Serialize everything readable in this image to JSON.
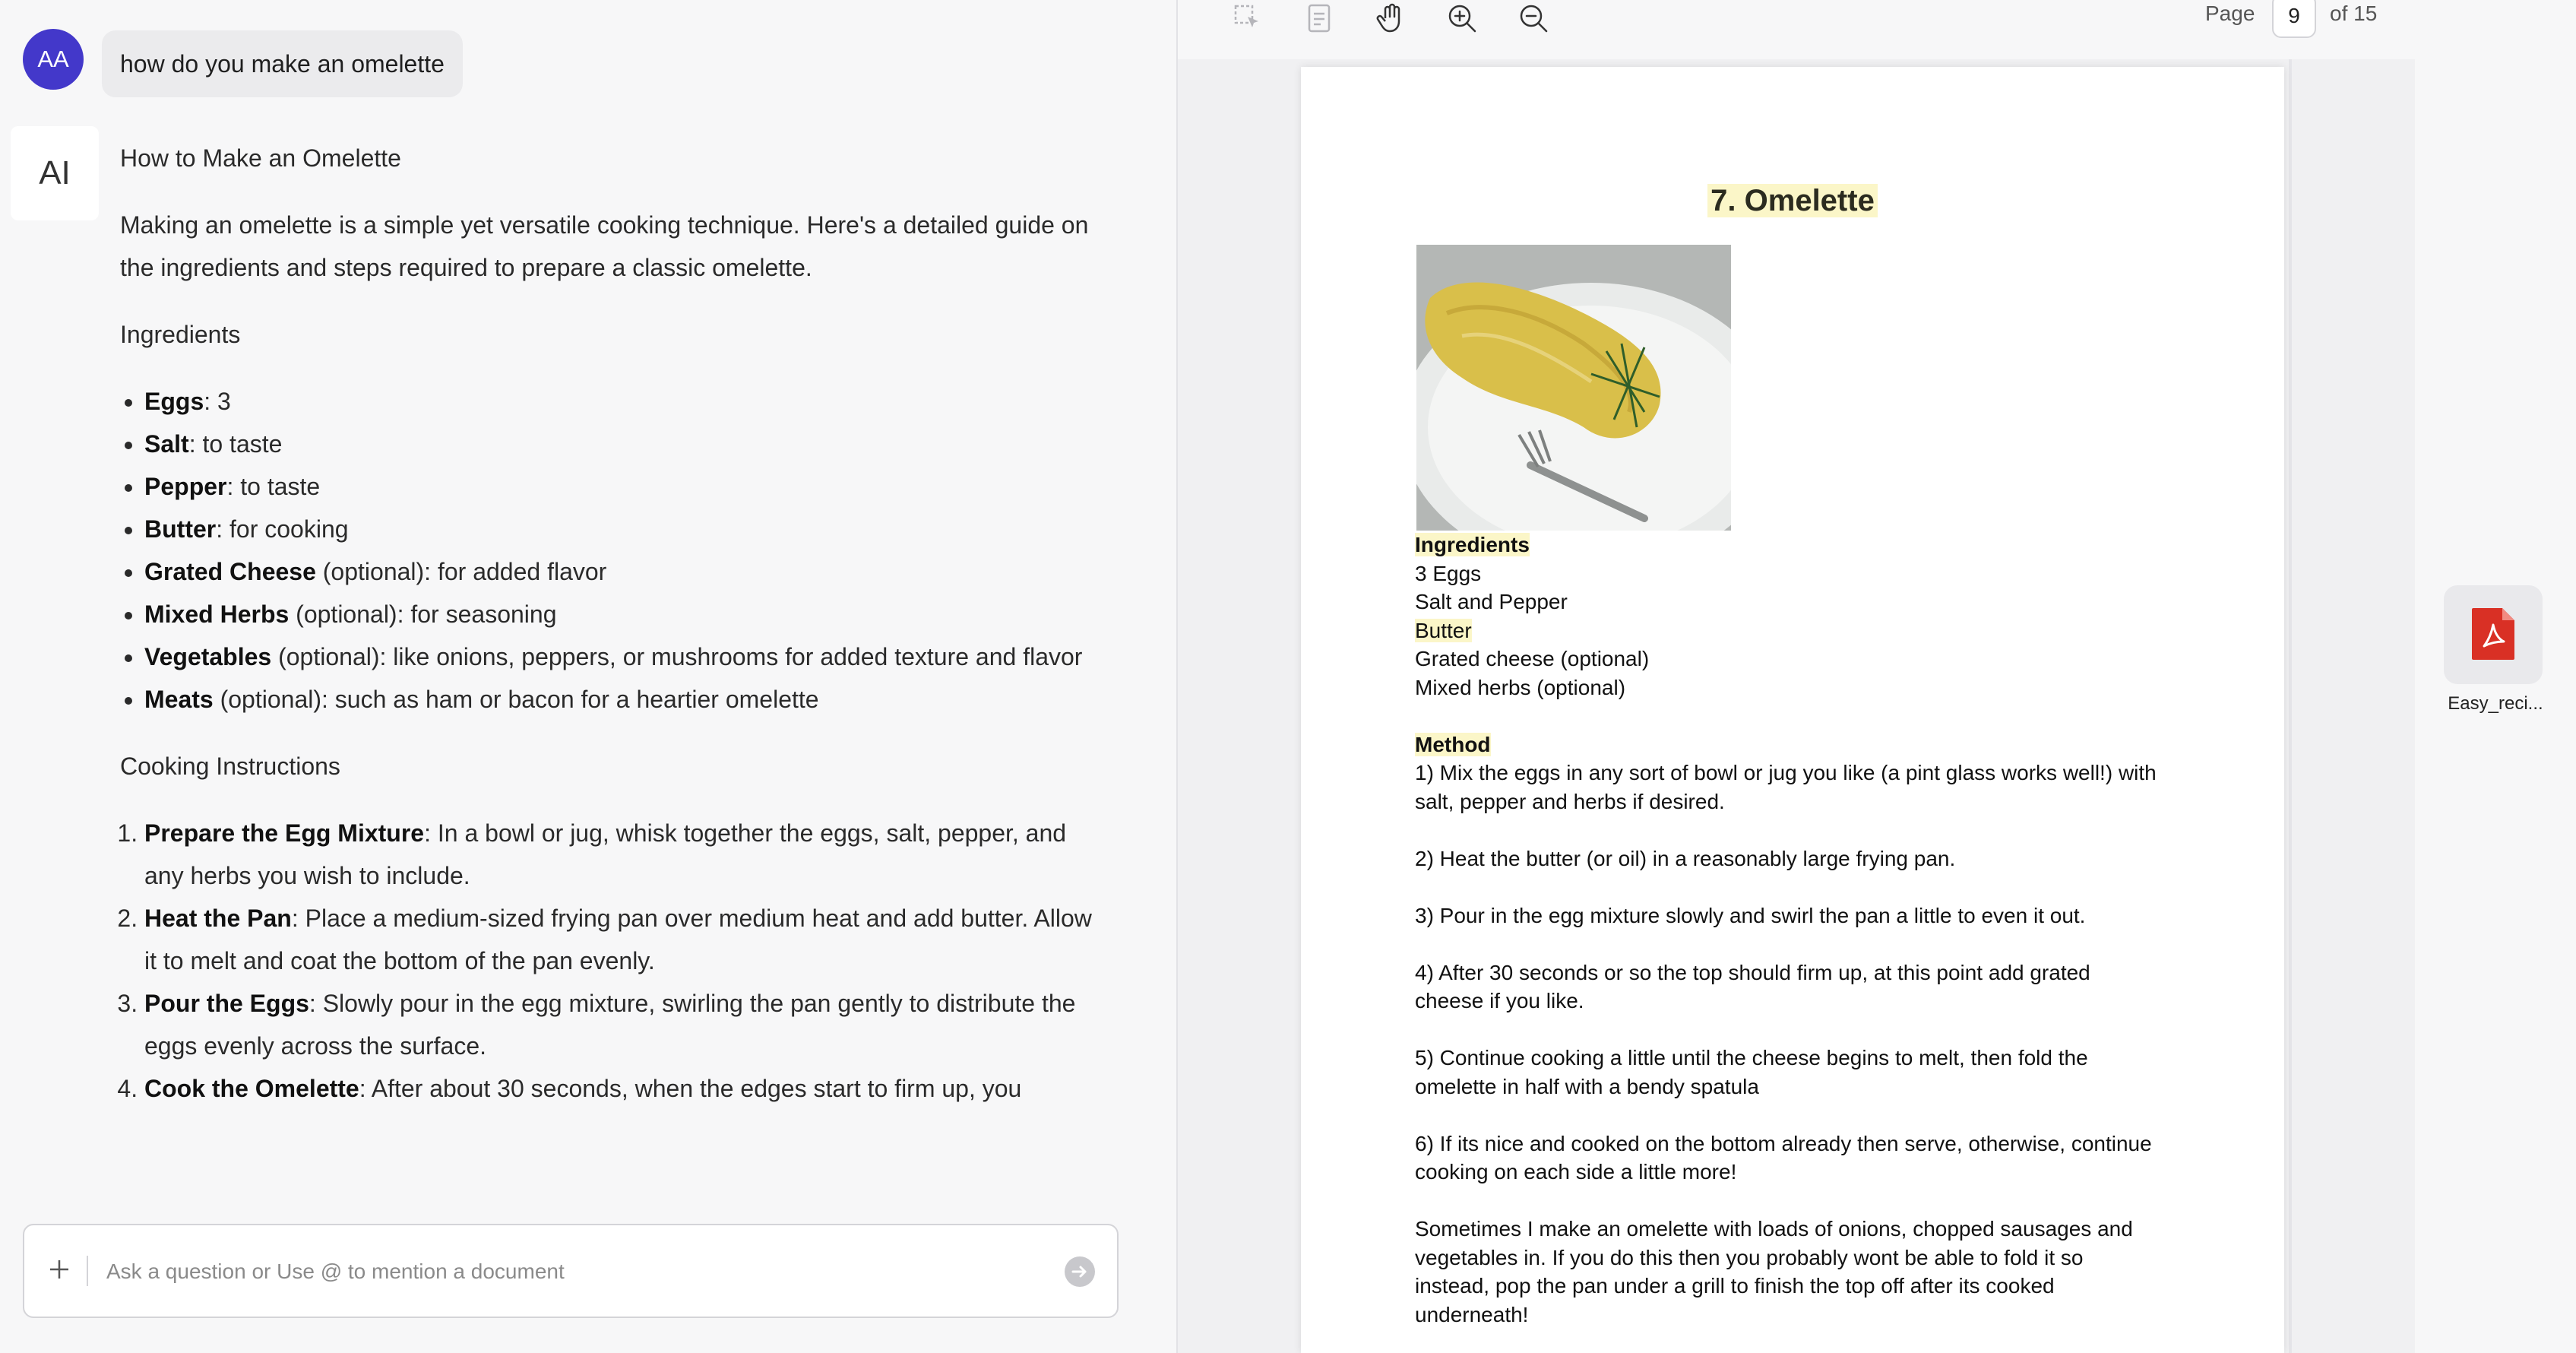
{
  "chat": {
    "user_initials": "AA",
    "user_message": "how do you make an omelette",
    "ai_label": "AI",
    "answer": {
      "title": "How to Make an Omelette",
      "intro": "Making an omelette is a simple yet versatile cooking technique. Here's a detailed guide on the ingredients and steps required to prepare a classic omelette.",
      "ingredients_heading": "Ingredients",
      "ingredients": [
        {
          "name": "Eggs",
          "rest": ": 3"
        },
        {
          "name": "Salt",
          "rest": ": to taste"
        },
        {
          "name": "Pepper",
          "rest": ": to taste"
        },
        {
          "name": "Butter",
          "rest": ": for cooking"
        },
        {
          "name": "Grated Cheese",
          "rest": " (optional): for added flavor"
        },
        {
          "name": "Mixed Herbs",
          "rest": " (optional): for seasoning"
        },
        {
          "name": "Vegetables",
          "rest": " (optional): like onions, peppers, or mushrooms for added texture and flavor"
        },
        {
          "name": "Meats",
          "rest": " (optional): such as ham or bacon for a heartier omelette"
        }
      ],
      "instructions_heading": "Cooking Instructions",
      "steps": [
        {
          "name": "Prepare the Egg Mixture",
          "rest": ": In a bowl or jug, whisk together the eggs, salt, pepper, and any herbs you wish to include."
        },
        {
          "name": "Heat the Pan",
          "rest": ": Place a medium-sized frying pan over medium heat and add butter. Allow it to melt and coat the bottom of the pan evenly."
        },
        {
          "name": "Pour the Eggs",
          "rest": ": Slowly pour in the egg mixture, swirling the pan gently to distribute the eggs evenly across the surface."
        },
        {
          "name": "Cook the Omelette",
          "rest": ": After about 30 seconds, when the edges start to firm up, you"
        }
      ]
    },
    "composer": {
      "placeholder": "Ask a question or Use @ to mention a document"
    }
  },
  "viewer": {
    "page_label": "Page",
    "current_page": "9",
    "total_label": "of 15",
    "icons": [
      "select-tool-icon",
      "text-tool-icon",
      "hand-tool-icon",
      "zoom-in-icon",
      "zoom-out-icon"
    ],
    "document": {
      "title": "7. Omelette",
      "ingredients_heading": "Ingredients",
      "ingredients_lines": [
        "3 Eggs",
        "Salt and Pepper",
        "Butter",
        "Grated cheese (optional)",
        "Mixed herbs (optional)"
      ],
      "method_heading": "Method",
      "method_steps": [
        [
          "1) Mix the eggs in any sort of bowl or jug you like (a pint glass works well!) with",
          "salt, pepper and herbs if desired."
        ],
        [
          "2) Heat the butter (or oil) in a reasonably large frying pan."
        ],
        [
          "3) Pour in the egg mixture slowly and swirl the pan a little to even it out."
        ],
        [
          "4) After 30 seconds or so the top should firm up, at this point add grated",
          "cheese if you like."
        ],
        [
          "5) Continue cooking a little until the cheese begins to melt, then fold the",
          "omelette in half with a bendy spatula"
        ],
        [
          "6) If its nice and cooked on the bottom already then serve, otherwise, continue",
          "cooking on each side a little more!"
        ]
      ],
      "closing_lines": [
        "Sometimes I make an omelette with loads of onions, chopped sausages and",
        "vegetables in. If you do this then you probably wont be able to fold it so",
        "instead, pop the pan under a grill to finish the top off after its cooked",
        "underneath!"
      ]
    }
  },
  "rail": {
    "file_name": "Easy_reci..."
  },
  "colors": {
    "user_avatar": "#4338ca",
    "highlight": "#fbf6c8",
    "pdf_icon": "#d93025"
  }
}
